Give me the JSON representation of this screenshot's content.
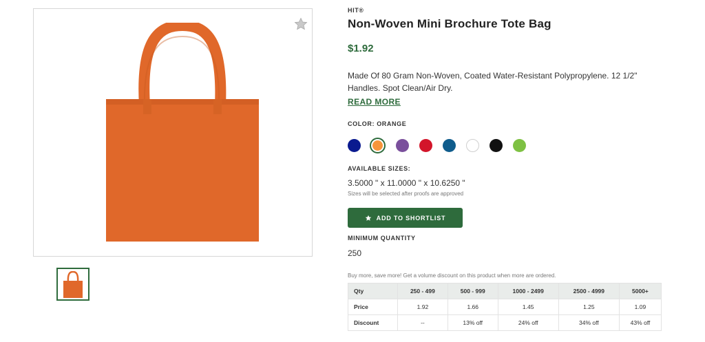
{
  "product": {
    "brand": "HIT®",
    "title": "Non-Woven Mini Brochure Tote Bag",
    "price": "$1.92",
    "description": "Made Of 80 Gram Non-Woven, Coated Water-Resistant Polypropylene. 12 1/2\" Handles. Spot Clean/Air Dry.",
    "read_more": "READ MORE",
    "image_color": "#e0682a"
  },
  "color": {
    "label": "COLOR: ORANGE",
    "selected": "Orange",
    "swatches": [
      {
        "name": "Navy",
        "hex": "#0a1a8f"
      },
      {
        "name": "Orange",
        "hex": "#f7953b",
        "selected": true
      },
      {
        "name": "Purple",
        "hex": "#7a4f9c"
      },
      {
        "name": "Red",
        "hex": "#d3152a"
      },
      {
        "name": "Royal Blue",
        "hex": "#0f5c8c"
      },
      {
        "name": "White",
        "hex": "#ffffff"
      },
      {
        "name": "Black",
        "hex": "#111111"
      },
      {
        "name": "Lime Green",
        "hex": "#7ec143"
      }
    ]
  },
  "sizes": {
    "label": "AVAILABLE SIZES:",
    "value": "3.5000 \" x 11.0000 \" x 10.6250 \"",
    "note": "Sizes will be selected after proofs are approved"
  },
  "shortlist": {
    "label": "ADD TO SHORTLIST",
    "icon": "star-icon"
  },
  "minimum": {
    "label": "MINIMUM QUANTITY",
    "value": "250"
  },
  "volume_note": "Buy more, save more! Get a volume discount on this product when more are ordered.",
  "pricing_table": {
    "headers": [
      "Qty",
      "250 - 499",
      "500 - 999",
      "1000 - 2499",
      "2500 - 4999",
      "5000+"
    ],
    "rows": [
      [
        "Price",
        "1.92",
        "1.66",
        "1.45",
        "1.25",
        "1.09"
      ],
      [
        "Discount",
        "--",
        "13% off",
        "24% off",
        "34% off",
        "43% off"
      ]
    ]
  },
  "colors": {
    "accent": "#2e6b3c",
    "table_header_bg": "#e9ecea"
  }
}
